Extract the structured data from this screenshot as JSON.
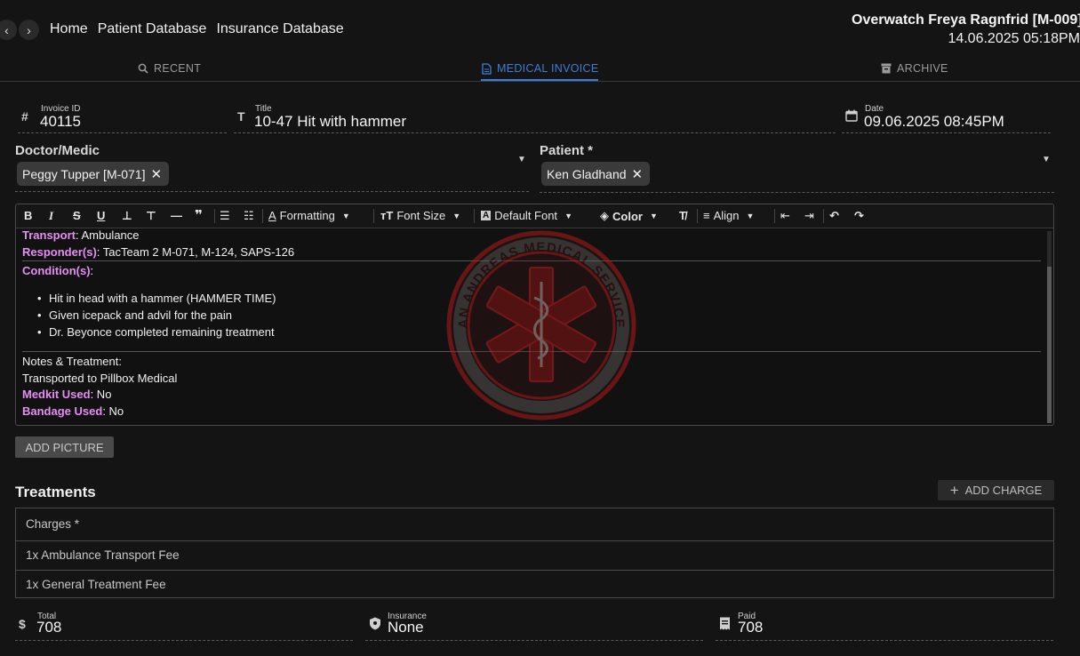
{
  "header": {
    "nav": [
      "Home",
      "Patient Database",
      "Insurance Database"
    ],
    "user": "Overwatch Freya Ragnfrid [M-009]",
    "datetime": "14.06.2025 05:18PM"
  },
  "tabs": [
    {
      "label": "RECENT",
      "icon": "search-icon"
    },
    {
      "label": "MEDICAL INVOICE",
      "icon": "document-icon"
    },
    {
      "label": "ARCHIVE",
      "icon": "archive-icon"
    }
  ],
  "active_tab": "MEDICAL INVOICE",
  "invoice": {
    "id_label": "Invoice ID",
    "id": "40115",
    "title_label": "Title",
    "title": "10-47 Hit with hammer",
    "date_label": "Date",
    "date": "09.06.2025 08:45PM"
  },
  "doctor": {
    "label": "Doctor/Medic",
    "value": "Peggy Tupper [M-071]"
  },
  "patient": {
    "label": "Patient *",
    "value": "Ken Gladhand"
  },
  "toolbar": {
    "formatting": "Formatting",
    "font_size": "Font Size",
    "default_font": "Default Font",
    "color": "Color",
    "align": "Align"
  },
  "report": {
    "transport_label": "Transport",
    "transport": ": Ambulance",
    "responders_label": "Responder(s)",
    "responders": ": TacTeam 2 M-071, M-124, SAPS-126",
    "conditions_label": "Condition(s)",
    "conditions_colon": ":",
    "conditions": [
      "Hit in head with a hammer (HAMMER TIME)",
      "Given icepack and advil for the pain",
      "Dr. Beyonce completed remaining treatment"
    ],
    "notes": "Notes & Treatment:",
    "notes_text": "Transported to Pillbox Medical",
    "medkit_label": "Medkit Used",
    "medkit": ": No",
    "bandage_label": "Bandage Used",
    "bandage": ": No"
  },
  "watermark": {
    "text": "SAN ANDREAS MEDICAL SERVICES"
  },
  "add_picture": "ADD PICTURE",
  "treatments": {
    "title": "Treatments",
    "add_charge": "ADD CHARGE",
    "header": "Charges *",
    "items": [
      "1x Ambulance Transport Fee",
      "1x General Treatment Fee"
    ]
  },
  "totals": {
    "total_label": "Total",
    "total": "708",
    "insurance_label": "Insurance",
    "insurance": "None",
    "paid_label": "Paid",
    "paid": "708"
  },
  "colors": {
    "accent": "#3d7fd6",
    "highlight": "#e58ef2",
    "background": "#141414"
  }
}
